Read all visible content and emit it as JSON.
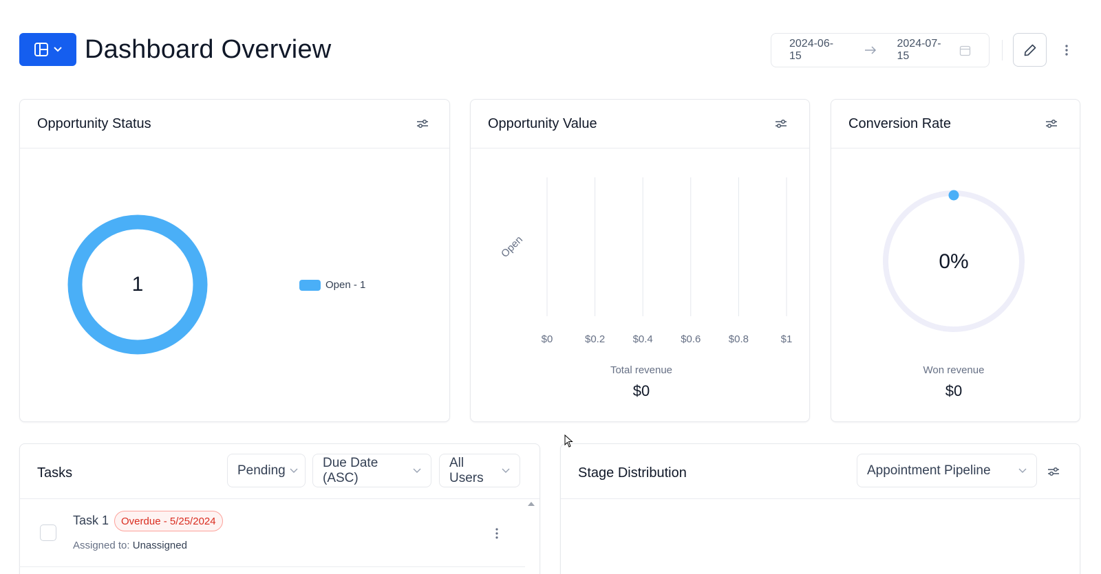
{
  "header": {
    "title": "Dashboard Overview",
    "layout_icon": "layout-grid-icon",
    "date_from": "2024-06-15",
    "date_to": "2024-07-15",
    "accent_color": "#155EEF"
  },
  "opportunity_status": {
    "title": "Opportunity Status",
    "total": "1",
    "legend_label": "Open - 1",
    "color": "#4AAFF7"
  },
  "opportunity_value": {
    "title": "Opportunity Value",
    "category_label": "Open",
    "total_label": "Total revenue",
    "total_value": "$0"
  },
  "conversion_rate": {
    "title": "Conversion Rate",
    "rate": "0%",
    "won_label": "Won revenue",
    "won_value": "$0"
  },
  "tasks": {
    "title": "Tasks",
    "filter_status": "Pending",
    "filter_sort": "Due Date (ASC)",
    "filter_users": "All Users",
    "items": [
      {
        "title": "Task 1",
        "badge": "Overdue - 5/25/2024",
        "assigned_label": "Assigned to:",
        "assigned_value": "Unassigned"
      }
    ]
  },
  "stage_distribution": {
    "title": "Stage Distribution",
    "pipeline": "Appointment Pipeline"
  },
  "chart_data": {
    "type": "bar",
    "categories": [
      "Open"
    ],
    "values": [
      0
    ],
    "xlim": [
      0,
      1
    ],
    "x_ticks": [
      "$0",
      "$0.2",
      "$0.4",
      "$0.6",
      "$0.8",
      "$1"
    ],
    "orientation": "horizontal",
    "grid": true
  }
}
